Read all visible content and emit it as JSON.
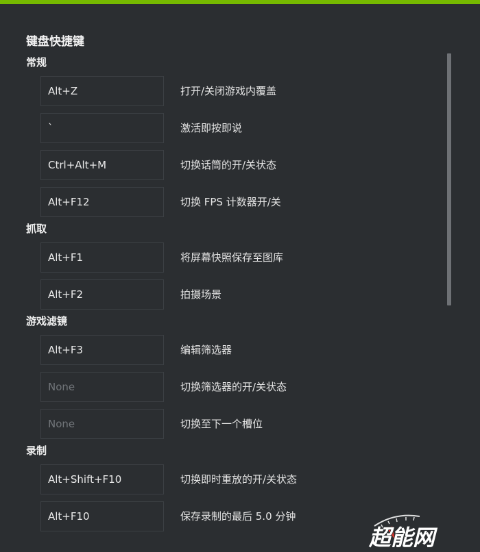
{
  "title": "键盘快捷键",
  "sections": [
    {
      "header": "常规",
      "rows": [
        {
          "key": "Alt+Z",
          "desc": "打开/关闭游戏内覆盖",
          "empty": false
        },
        {
          "key": "`",
          "desc": "激活即按即说",
          "empty": false
        },
        {
          "key": "Ctrl+Alt+M",
          "desc": "切换话筒的开/关状态",
          "empty": false
        },
        {
          "key": "Alt+F12",
          "desc": "切换 FPS 计数器开/关",
          "empty": false
        }
      ]
    },
    {
      "header": "抓取",
      "rows": [
        {
          "key": "Alt+F1",
          "desc": "将屏幕快照保存至图库",
          "empty": false
        },
        {
          "key": "Alt+F2",
          "desc": "拍摄场景",
          "empty": false
        }
      ]
    },
    {
      "header": "游戏滤镜",
      "rows": [
        {
          "key": "Alt+F3",
          "desc": "编辑筛选器",
          "empty": false
        },
        {
          "key": "None",
          "desc": "切换筛选器的开/关状态",
          "empty": true
        },
        {
          "key": "None",
          "desc": "切换至下一个槽位",
          "empty": true
        }
      ]
    },
    {
      "header": "录制",
      "rows": [
        {
          "key": "Alt+Shift+F10",
          "desc": "切换即时重放的开/关状态",
          "empty": false
        },
        {
          "key": "Alt+F10",
          "desc": "保存录制的最后 5.0 分钟",
          "empty": false
        }
      ]
    }
  ],
  "watermark": {
    "text": "超能网",
    "color": "#ffffff",
    "accent": "#d9342b"
  },
  "colors": {
    "accent_bar": "#76b900",
    "background": "#2b2e31"
  }
}
